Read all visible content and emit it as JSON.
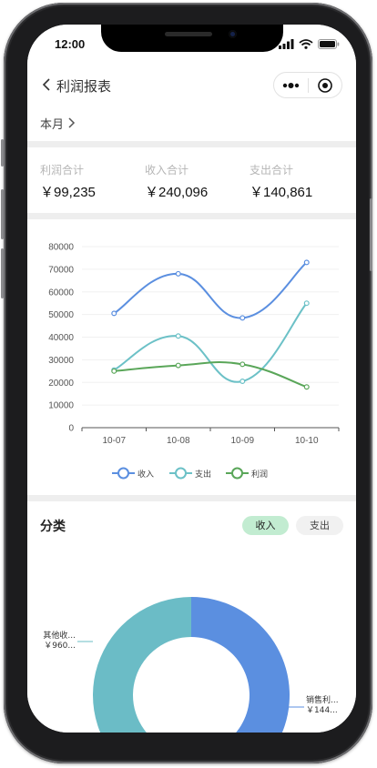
{
  "status": {
    "time": "12:00"
  },
  "nav": {
    "title": "利润报表"
  },
  "period": {
    "label": "本月"
  },
  "summary": [
    {
      "label": "利润合计",
      "value": "￥99,235"
    },
    {
      "label": "收入合计",
      "value": "￥240,096"
    },
    {
      "label": "支出合计",
      "value": "￥140,861"
    }
  ],
  "chart_data": {
    "type": "line",
    "categories": [
      "10-07",
      "10-08",
      "10-09",
      "10-10"
    ],
    "ylim": [
      0,
      80000
    ],
    "yticks": [
      "0",
      "10000",
      "20000",
      "30000",
      "40000",
      "50000",
      "60000",
      "70000",
      "80000"
    ],
    "series": [
      {
        "name": "收入",
        "color": "#5b8fe0",
        "values": [
          50500,
          68000,
          48500,
          73000
        ]
      },
      {
        "name": "支出",
        "color": "#6cc1c7",
        "values": [
          25500,
          40500,
          20500,
          55000
        ]
      },
      {
        "name": "利润",
        "color": "#5aa659",
        "values": [
          25000,
          27500,
          28000,
          18000
        ]
      }
    ],
    "grid": true,
    "legend": "bottom"
  },
  "category": {
    "title": "分类",
    "tabs": {
      "income": "收入",
      "expense": "支出"
    },
    "donut": [
      {
        "label": "销售利...",
        "amount": "￥144...",
        "share": 0.6,
        "color": "#5b8fe0"
      },
      {
        "label": "其他收...",
        "amount": "￥960...",
        "share": 0.4,
        "color": "#6bbcc6"
      }
    ]
  },
  "icons": {
    "back": "chevron-left-icon",
    "more": "more-dots-icon",
    "close": "target-icon",
    "period_arrow": "chevron-right-icon"
  }
}
